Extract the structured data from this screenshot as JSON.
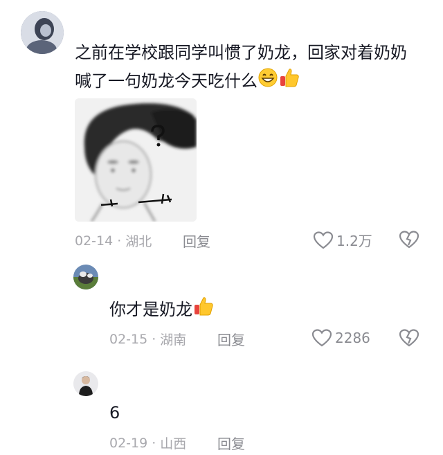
{
  "comment": {
    "text": "之前在学校跟同学叫惯了奶龙，回家对着奶奶喊了一句奶龙今天吃什么",
    "emojis": [
      "grin-icon",
      "thumbs-up-icon"
    ],
    "date": "02-14",
    "location": "湖北",
    "reply_label": "回复",
    "likes": "1.2万"
  },
  "replies": [
    {
      "text": "你才是奶龙",
      "emojis": [
        "thumbs-up-icon"
      ],
      "date": "02-15",
      "location": "湖南",
      "reply_label": "回复",
      "likes": "2286"
    },
    {
      "text": "6",
      "date": "02-19",
      "location": "山西",
      "reply_label": "回复"
    }
  ],
  "separator": "·",
  "colors": {
    "text": "#161823",
    "meta": "#a8a8ad",
    "icon": "#8a8b91"
  }
}
